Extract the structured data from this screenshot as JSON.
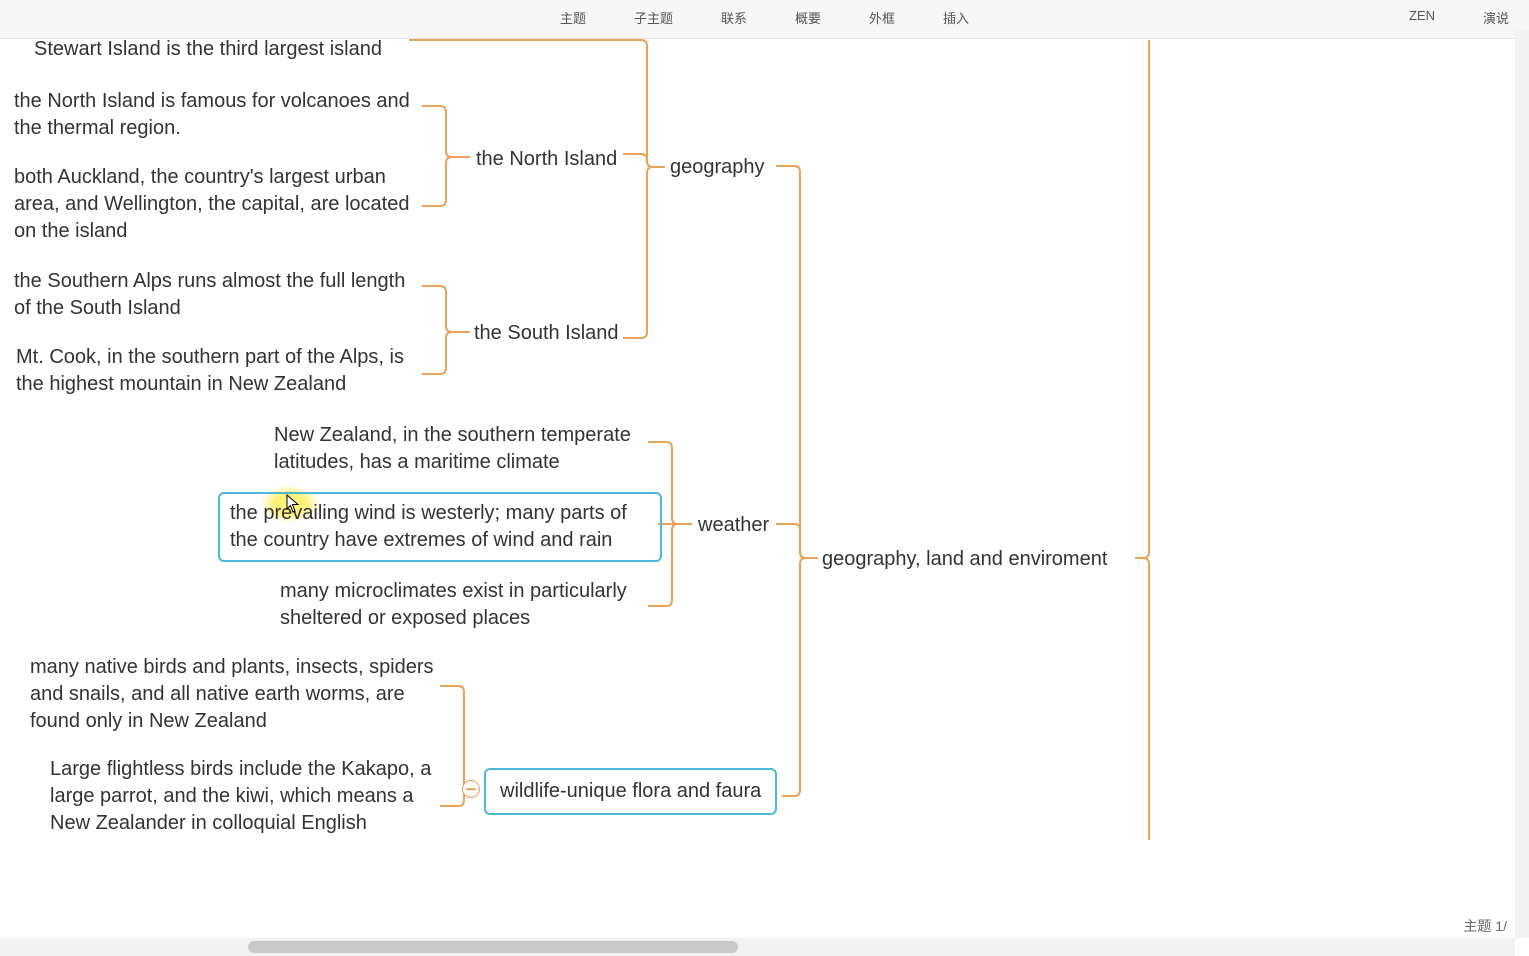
{
  "toolbar": {
    "center": [
      "主题",
      "子主题",
      "联系",
      "概要",
      "外框",
      "插入"
    ],
    "right": [
      "ZEN",
      "演说"
    ]
  },
  "nodes": {
    "stewart": "Stewart Island is the third largest island",
    "northFamous": "the North Island is famous for volcanoes and the thermal region.",
    "auckland": "both Auckland, the country's largest urban area, and Wellington, the capital, are located on the island",
    "northIsland": "the North Island",
    "southernAlps": "the Southern Alps runs almost the full length of the South Island",
    "mtCook": "Mt. Cook, in the southern part of the Alps, is the highest mountain in New Zealand",
    "southIsland": "the South Island",
    "geography": "geography",
    "maritime": "New Zealand, in the southern temperate latitudes, has a maritime climate",
    "prevailing": "the prevailing wind is westerly; many parts of the country have extremes of wind and rain",
    "microclimates": "many microclimates exist in particularly sheltered or exposed places",
    "weather": "weather",
    "native": "many native birds and plants, insects, spiders and snails, and all native earth worms, are found only in New Zealand",
    "flightless": "Large flightless birds include the Kakapo, a large parrot, and the kiwi, which means a New Zealander in colloquial English",
    "wildlife": "wildlife-unique flora and faura",
    "root": "geography, land and enviroment"
  },
  "status": "主题  1/"
}
